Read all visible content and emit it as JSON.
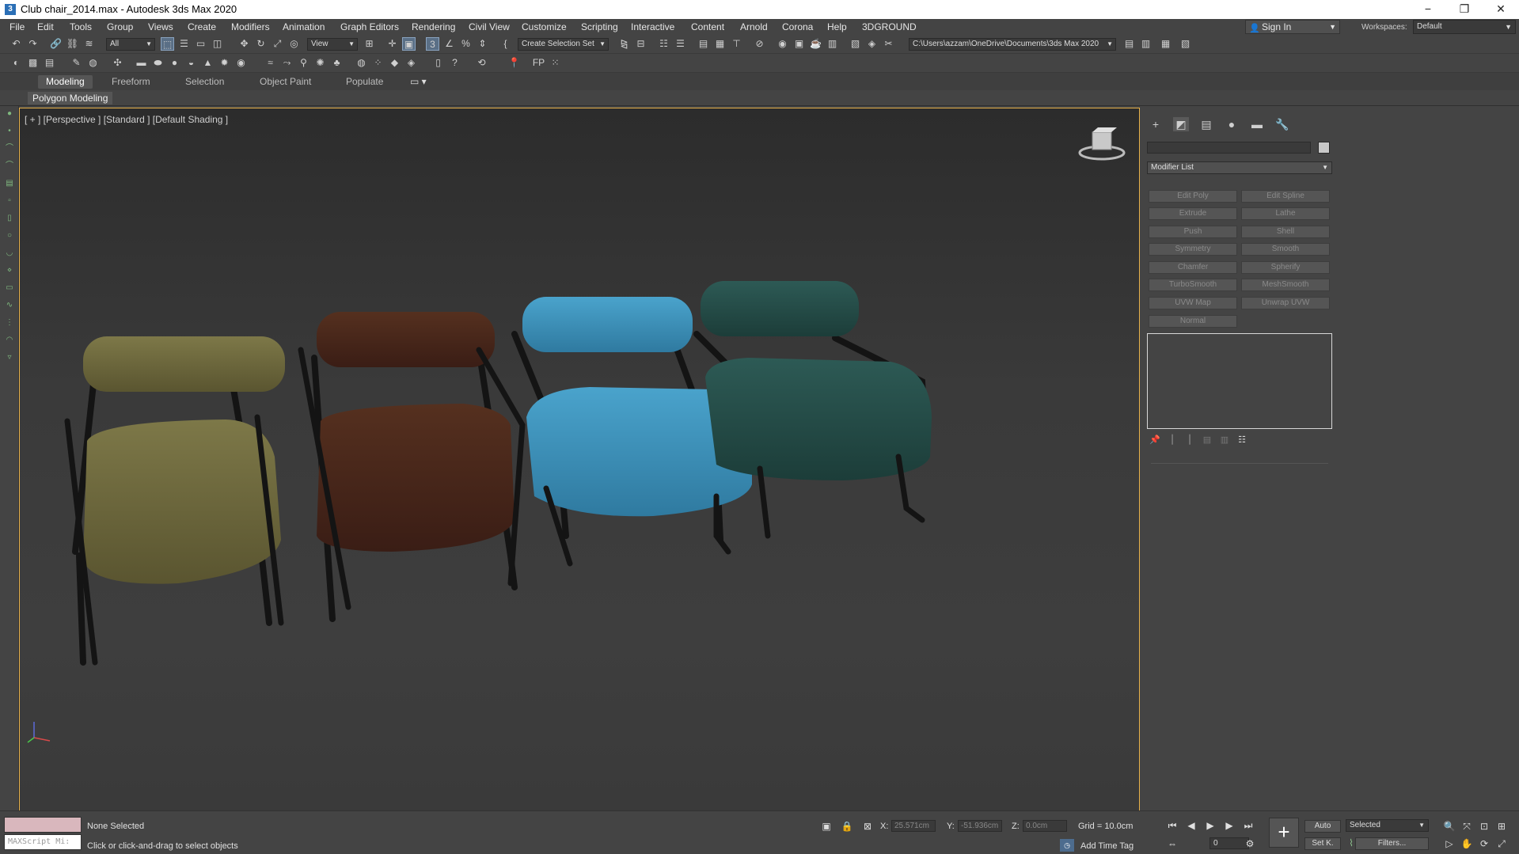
{
  "titlebar": {
    "title": "Club chair_2014.max - Autodesk 3ds Max 2020",
    "app_icon": "3",
    "minimize": "−",
    "maximize": "❐",
    "close": "✕"
  },
  "menubar": [
    "File",
    "Edit",
    "Tools",
    "Group",
    "Views",
    "Create",
    "Modifiers",
    "Animation",
    "Graph Editors",
    "Rendering",
    "Civil View",
    "Customize",
    "Scripting",
    "Interactive",
    "Content",
    "Arnold",
    "Corona",
    "Help",
    "3DGROUND"
  ],
  "account": {
    "signin": "Sign In",
    "workspaces_label": "Workspaces:",
    "workspace": "Default"
  },
  "toolbar1": {
    "selection_filter": "All",
    "ref_coord": "View",
    "named_selection": "Create Selection Set",
    "project_path": "C:\\Users\\azzam\\OneDrive\\Documents\\3ds Max 2020"
  },
  "ribbon": {
    "tabs": [
      "Modeling",
      "Freeform",
      "Selection",
      "Object Paint",
      "Populate"
    ],
    "active_tab": "Modeling",
    "panel_label": "Polygon Modeling"
  },
  "viewport": {
    "label": "[ + ] [Perspective ] [Standard ] [Default Shading ]",
    "chairs": [
      {
        "name": "chair-olive",
        "color": "#6f6a3a"
      },
      {
        "name": "chair-brown",
        "color": "#4a2a22"
      },
      {
        "name": "chair-blue",
        "color": "#3b8ab0"
      },
      {
        "name": "chair-teal",
        "color": "#254a45"
      }
    ],
    "frame_color": "#1a1a1a",
    "border_color": "#e7b14a"
  },
  "command_panel": {
    "tabs": [
      "create-icon",
      "modify-icon",
      "hierarchy-icon",
      "motion-icon",
      "display-icon",
      "utilities-icon"
    ],
    "modifier_list": "Modifier List",
    "modifier_buttons": [
      "Edit Poly",
      "Edit Spline",
      "Extrude",
      "Lathe",
      "Push",
      "Shell",
      "Symmetry",
      "Smooth",
      "Chamfer",
      "Spherify",
      "TurboSmooth",
      "MeshSmooth",
      "UVW Map",
      "Unwrap UVW",
      "Normal"
    ]
  },
  "status": {
    "maxscript": "MAXScript Mi:",
    "selection": "None Selected",
    "prompt": "Click or click-and-drag to select objects",
    "x_label": "X:",
    "x_value": "25.571cm",
    "y_label": "Y:",
    "y_value": "-51.936cm",
    "z_label": "Z:",
    "z_value": "0.0cm",
    "grid": "Grid = 10.0cm",
    "add_time_tag": "Add Time Tag",
    "frame": "0",
    "auto": "Auto",
    "set_key": "Set K.",
    "selected_dd": "Selected",
    "filters": "Filters..."
  }
}
